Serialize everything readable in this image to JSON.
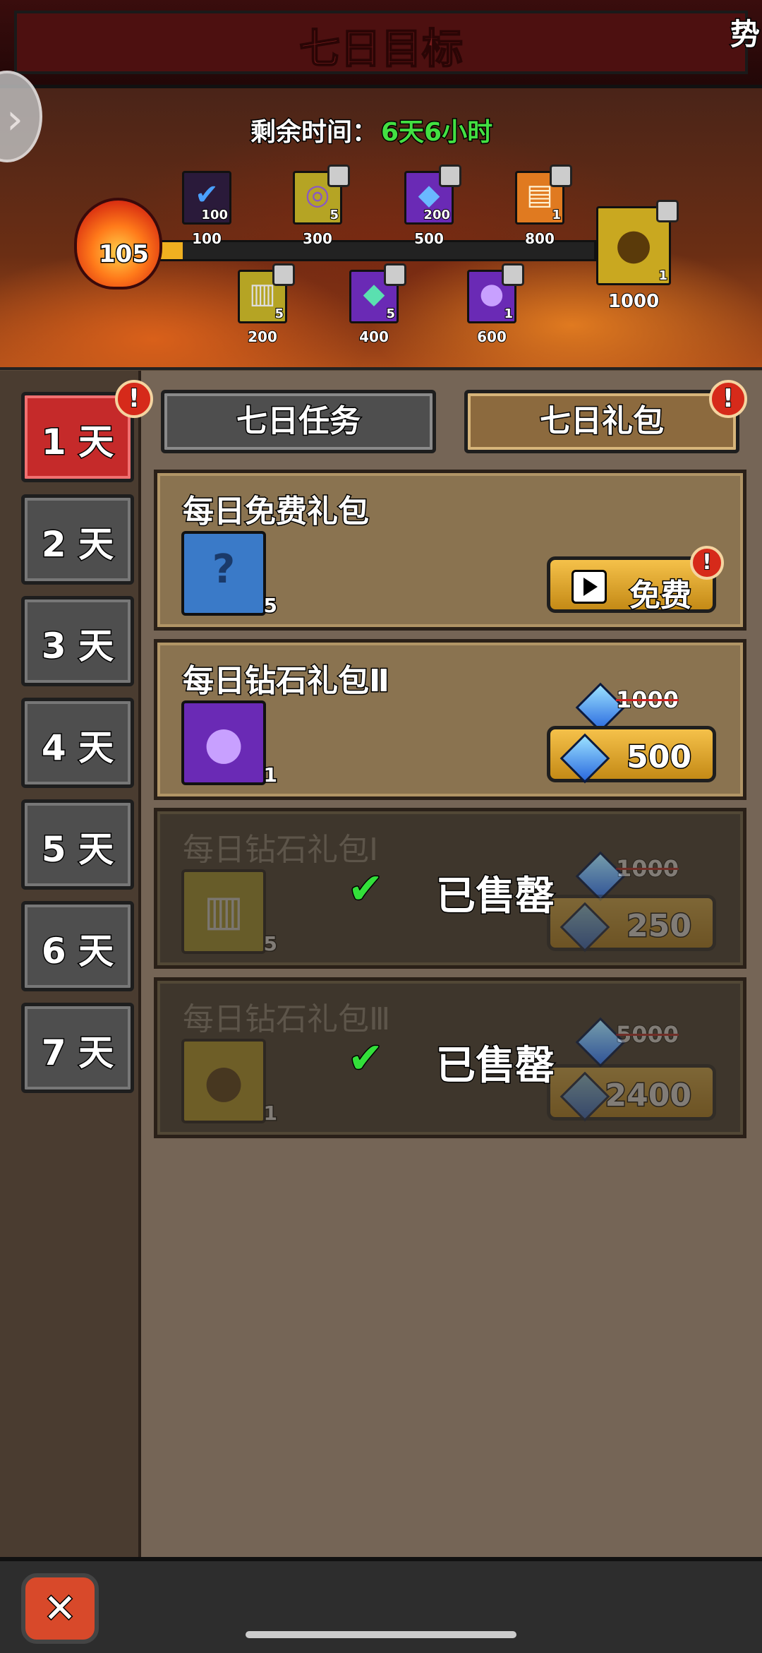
{
  "header": {
    "title": "七日目标",
    "corner_text": "势"
  },
  "timer": {
    "label": "剩余时间：",
    "value": "6天6小时"
  },
  "progress": {
    "score": "105",
    "fill_fraction": 0.05
  },
  "milestones": [
    {
      "label": "100",
      "count": "100",
      "icon": "checkmark-gem-icon",
      "color": "#2a1a3a",
      "claimed": true
    },
    {
      "label": "300",
      "count": "5",
      "icon": "scroll-icon",
      "color": "#b5a424"
    },
    {
      "label": "500",
      "count": "200",
      "icon": "diamond-icon",
      "color": "#6a2ab5"
    },
    {
      "label": "800",
      "count": "1",
      "icon": "map-scroll-icon",
      "color": "#e07a20"
    },
    {
      "label": "1000",
      "count": "1",
      "icon": "gold-bag-icon",
      "color": "#c9a820"
    },
    {
      "label": "200",
      "count": "5",
      "icon": "scroll-icon",
      "color": "#b5a424"
    },
    {
      "label": "400",
      "count": "5",
      "icon": "crystal-icon",
      "color": "#6a2ab5"
    },
    {
      "label": "600",
      "count": "1",
      "icon": "purple-bag-icon",
      "color": "#6a2ab5"
    }
  ],
  "days": [
    "1 天",
    "2 天",
    "3 天",
    "4 天",
    "5 天",
    "6 天",
    "7 天"
  ],
  "tabs": {
    "task": "七日任务",
    "gift": "七日礼包"
  },
  "packs": [
    {
      "title": "每日免费礼包",
      "count": "5",
      "button": "免费"
    },
    {
      "title": "每日钻石礼包Ⅱ",
      "count": "1",
      "old_price": "1000",
      "price": "500"
    },
    {
      "title": "每日钻石礼包Ⅰ",
      "count": "5",
      "old_price": "1000",
      "price": "250",
      "sold": "已售罄"
    },
    {
      "title": "每日钻石礼包Ⅲ",
      "count": "1",
      "old_price": "5000",
      "price": "2400",
      "sold": "已售罄"
    }
  ],
  "exclaim": "!",
  "check_glyph": "✔"
}
